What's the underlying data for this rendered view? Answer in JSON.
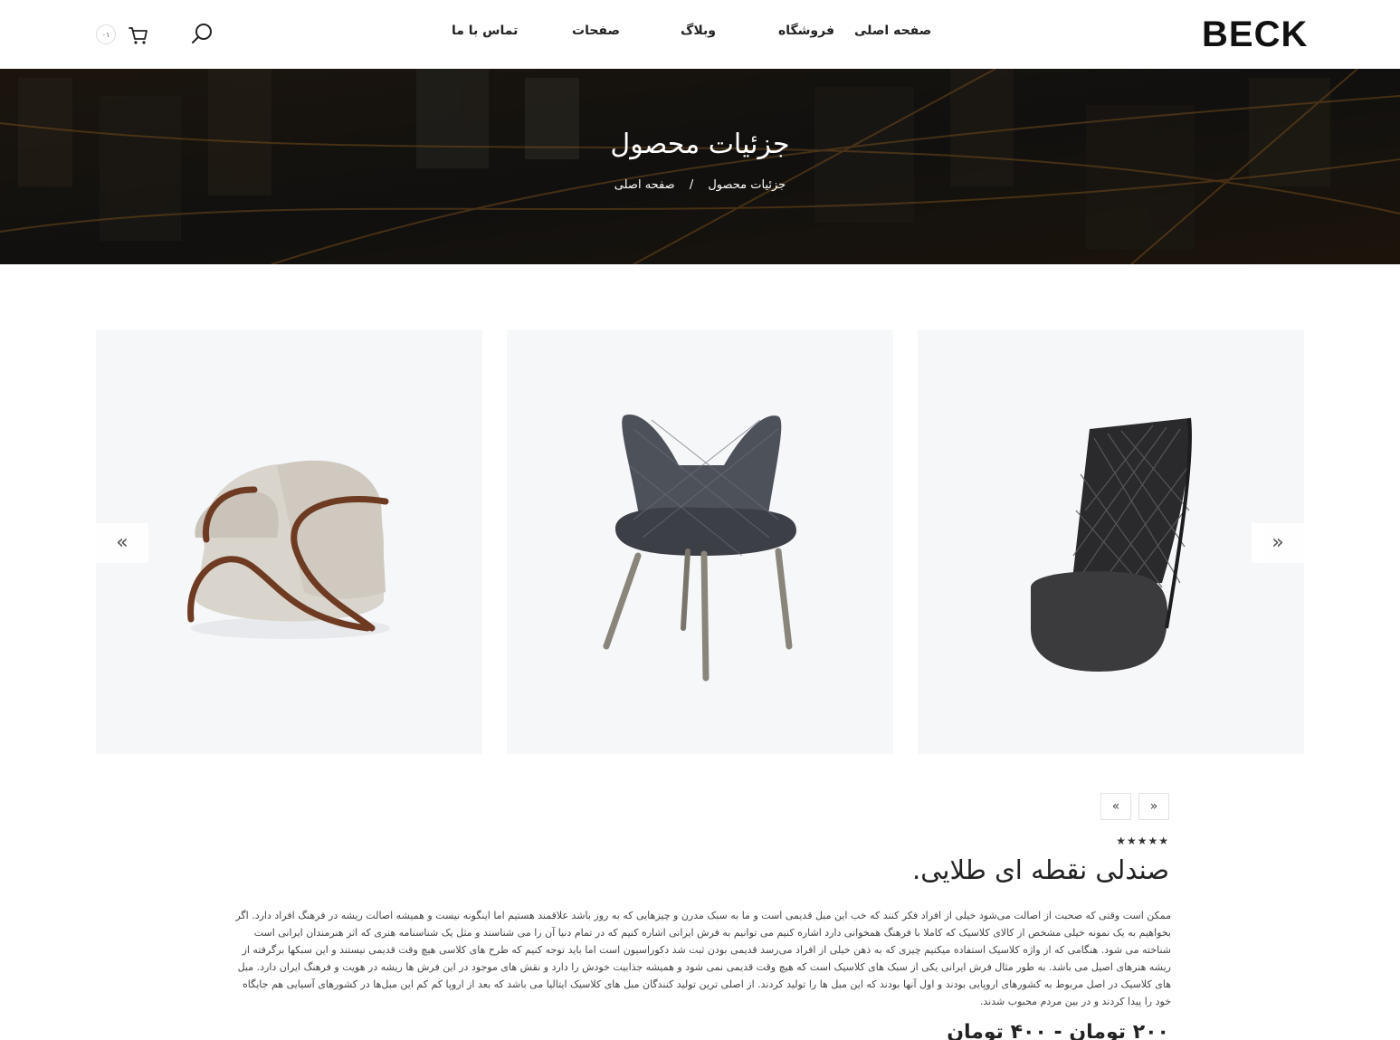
{
  "header": {
    "logo": "BECK",
    "nav": {
      "home": "صفحه اصلی",
      "shop": "فروشگاه",
      "blog": "وبلاگ",
      "pages": "صفحات",
      "contact": "تماس با ما"
    },
    "cart_count": "۰۱"
  },
  "hero": {
    "title": "جزئیات محصول",
    "breadcrumb": {
      "current": "جزئیات محصول",
      "separator": "/",
      "home": "صفحه اصلی"
    }
  },
  "slider": {
    "prev_icon": "«",
    "next_icon": "»"
  },
  "product": {
    "nav_next": "»",
    "nav_prev": "«",
    "rating_stars": "★★★★★",
    "title": "صندلی نقطه ای طلایی.",
    "description": "ممکن است وقتی که صحبت از اصالت می‌شود خیلی از افراد فکر کنند که خب این مبل قدیمی است و ما به سبک مدرن و چیزهایی که به روز باشد علاقمند هستیم اما اینگونه نیست و همیشه اصالت ریشه در فرهنگ افراد دارد. اگر بخواهیم به یک نمونه خیلی مشخص از کالای کلاسیک که کاملا با فرهنگ همخوانی دارد اشاره کنیم می توانیم به فرش ایرانی اشاره کنیم که در تمام دنیا آن را می شناسند و مثل یک شناسنامه هنری که اثر هنرمندان ایرانی است شناخته می شود. هنگامی که از واژه کلاسیک استفاده میکنیم چیزی که به ذهن خیلی از افراد می‌رسد قدیمی بودن ثبت شد دکوراسیون است اما باید توجه کنیم که طرح های کلاسی هیچ وقت قدیمی نیستند و این سبکها برگرفته از ریشه هنرهای اصیل می باشد. به طور مثال فرش ایرانی یکی از سبک های کلاسیک است که هیچ وقت قدیمی نمی شود و همیشه جذابیت خودش را دارد و نقش های موجود در این فرش ها ریشه در هویت و فرهنگ ایران دارد. مبل های کلاسیک در اصل مربوط به کشورهای اروپایی بودند و اول آنها بودند که این مبل ها را تولید کردند. از اصلی ترین تولید کنندگان مبل های کلاسیک ایتالیا می باشد که بعد از اروپا کم کم این مبل‌ها در کشورهای آسیایی هم جایگاه خود را پیدا کردند و در بین مردم محبوب شدند.",
    "price": "۲۰۰ تومان - ۴۰۰ تومان"
  },
  "colors": {
    "card_bg": "#f5f7f9",
    "text": "#222222"
  }
}
